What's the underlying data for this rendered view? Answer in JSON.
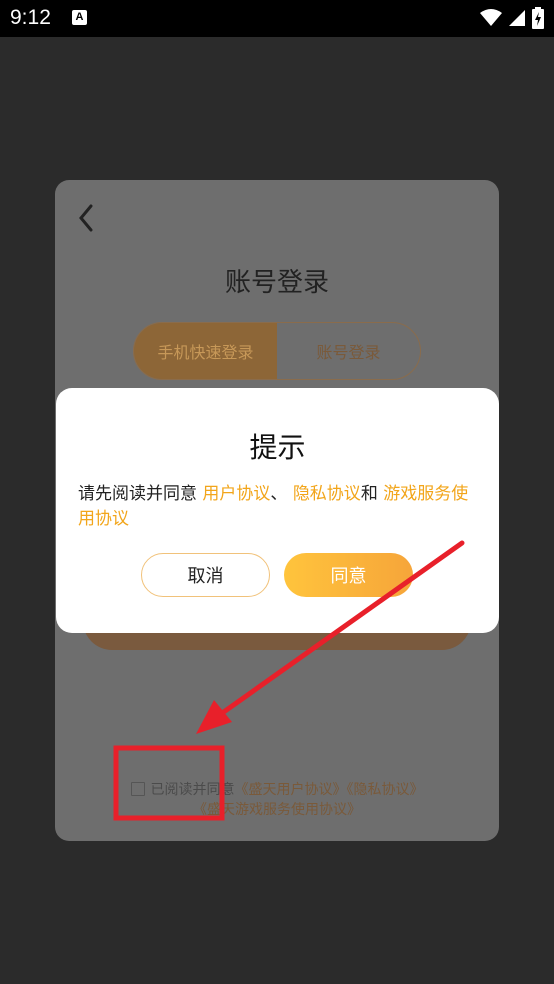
{
  "status_bar": {
    "time": "9:12",
    "notification_icon": "accessibility-a-icon",
    "icons": [
      "wifi-icon",
      "cellular-signal-icon",
      "battery-charging-icon"
    ]
  },
  "login_card": {
    "title": "账号登录",
    "tabs": [
      {
        "label": "手机快速登录",
        "active": true
      },
      {
        "label": "账号登录",
        "active": false
      }
    ],
    "agreement": {
      "prefix": "已阅读并同意",
      "link1": "《盛天用户协议》",
      "link2": "《隐私协议》",
      "link3": "《盛天游戏服务使用协议》"
    }
  },
  "dialog": {
    "title": "提示",
    "body_prefix": "请先阅读并同意 ",
    "link_user": "用户协议",
    "sep1": "、 ",
    "link_privacy": "隐私协议",
    "sep2": "和 ",
    "link_service": "游戏服务使用协议",
    "cancel_label": "取消",
    "agree_label": "同意"
  },
  "colors": {
    "accent": "#f2a51a",
    "annotation_red": "#e8202a",
    "overlay": "#2b2b2b"
  }
}
